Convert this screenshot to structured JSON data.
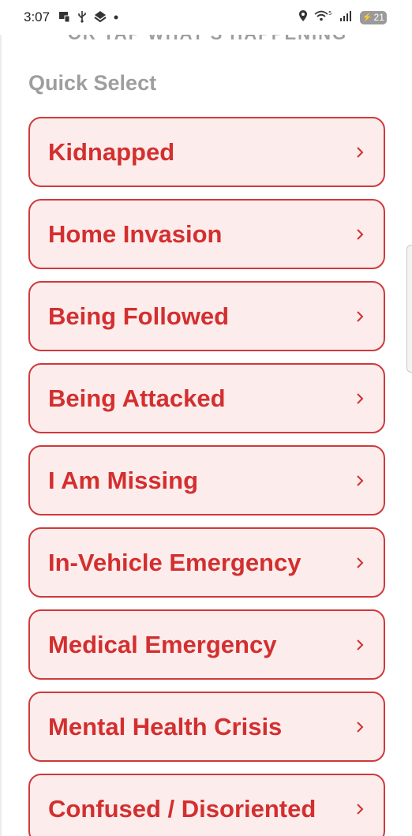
{
  "status_bar": {
    "time": "3:07",
    "left_icons": [
      "screen-share-icon",
      "usb-icon",
      "app-icon",
      "dot-icon"
    ],
    "right_icons": [
      "location-icon",
      "wifi-icon",
      "signal-icon"
    ],
    "wifi_label": "5",
    "battery_level": "21"
  },
  "header": {
    "or_tap_text": "OR TAP WHAT'S HAPPENING"
  },
  "quick_select": {
    "title": "Quick Select",
    "options": [
      {
        "label": "Kidnapped"
      },
      {
        "label": "Home Invasion"
      },
      {
        "label": "Being Followed"
      },
      {
        "label": "Being Attacked"
      },
      {
        "label": "I Am Missing"
      },
      {
        "label": "In-Vehicle Emergency"
      },
      {
        "label": "Medical Emergency"
      },
      {
        "label": "Mental Health Crisis"
      },
      {
        "label": "Confused / Disoriented"
      }
    ]
  },
  "colors": {
    "accent": "#d32f2f",
    "border": "#d0393b",
    "option_bg": "#fcecec",
    "muted_text": "#9e9e9e"
  }
}
